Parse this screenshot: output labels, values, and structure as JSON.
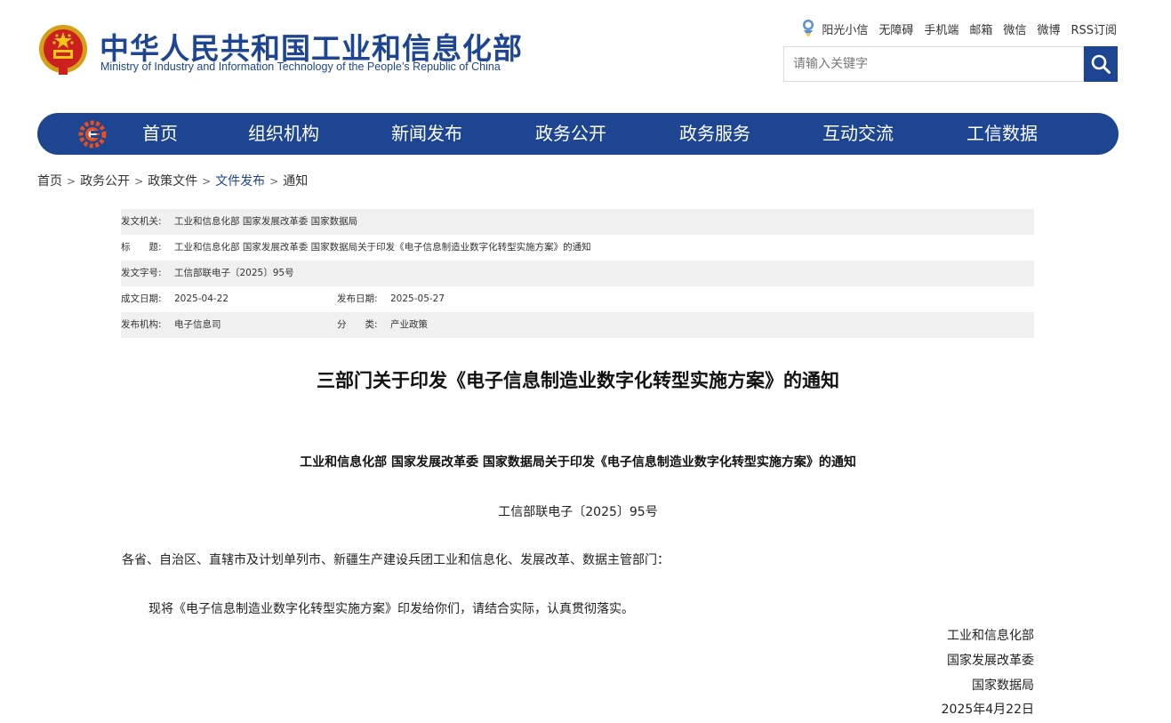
{
  "header": {
    "title_cn": "中华人民共和国工业和信息化部",
    "title_en": "Ministry of Industry and Information Technology of the People’s Republic of China",
    "top_links": [
      "阳光小信",
      "无障碍",
      "手机端",
      "邮箱",
      "微信",
      "微博",
      "RSS订阅"
    ],
    "search_placeholder": "请输入关键字"
  },
  "nav": {
    "items": [
      "首页",
      "组织机构",
      "新闻发布",
      "政务公开",
      "政务服务",
      "互动交流",
      "工信数据"
    ]
  },
  "breadcrumb": [
    "首页",
    "政务公开",
    "政策文件",
    "文件发布",
    "通知"
  ],
  "meta": {
    "issuer_label": "发文机关:",
    "issuer": "工业和信息化部 国家发展改革委 国家数据局",
    "title_label": "标　　题:",
    "title": "工业和信息化部 国家发展改革委 国家数据局关于印发《电子信息制造业数字化转型实施方案》的通知",
    "docno_label": "发文字号:",
    "docno": "工信部联电子〔2025〕95号",
    "written_label": "成文日期:",
    "written": "2025-04-22",
    "published_label": "发布日期:",
    "published": "2025-05-27",
    "org_label": "发布机构:",
    "org": "电子信息司",
    "category_label": "分　　类:",
    "category": "产业政策"
  },
  "article": {
    "title": "三部门关于印发《电子信息制造业数字化转型实施方案》的通知",
    "subtitle": "工业和信息化部 国家发展改革委 国家数据局关于印发《电子信息制造业数字化转型实施方案》的通知",
    "doc_no": "工信部联电子〔2025〕95号",
    "recipients": "各省、自治区、直辖市及计划单列市、新疆生产建设兵团工业和信息化、发展改革、数据主管部门：",
    "body": "现将《电子信息制造业数字化转型实施方案》印发给你们，请结合实际，认真贯彻落实。",
    "signatures": [
      "工业和信息化部",
      "国家发展改革委",
      "国家数据局",
      "2025年4月22日"
    ]
  },
  "colors": {
    "brand": "#1d4591",
    "meta_shade": "#f0f0f0"
  },
  "icons": [
    "national-emblem-icon",
    "sunshine-mascot-icon",
    "search-icon",
    "miit-gear-logo-icon"
  ]
}
